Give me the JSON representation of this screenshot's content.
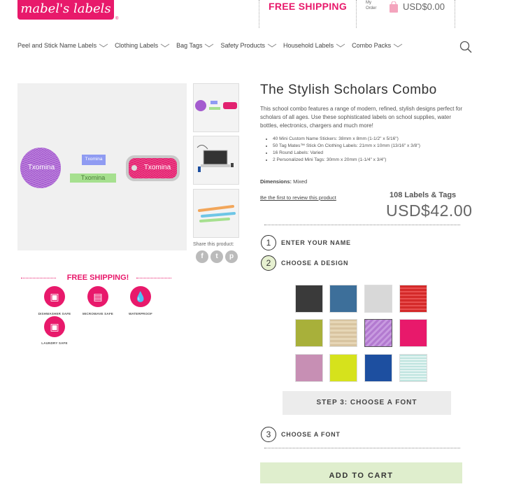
{
  "header": {
    "logo_text": "mabel's labels",
    "logo_mark": "®",
    "free_shipping": "FREE SHIPPING",
    "my_order": "My Order",
    "cart_total": "USD$0.00"
  },
  "nav": [
    {
      "label": "Peel and Stick Name Labels"
    },
    {
      "label": "Clothing Labels"
    },
    {
      "label": "Bag Tags"
    },
    {
      "label": "Safety Products"
    },
    {
      "label": "Household Labels"
    },
    {
      "label": "Combo Packs"
    }
  ],
  "gallery": {
    "sample_name": "Txomina",
    "share_text": "Share this product:"
  },
  "shipping": {
    "title": "FREE SHIPPING!",
    "badges": [
      {
        "label": "DISHWASHER SAFE",
        "icon": "dishwasher-icon"
      },
      {
        "label": "MICROWAVE SAFE",
        "icon": "microwave-icon"
      },
      {
        "label": "WATERPROOF",
        "icon": "waterproof-icon"
      },
      {
        "label": "LAUNDRY SAFE",
        "icon": "laundry-icon"
      }
    ]
  },
  "product": {
    "title": "The Stylish Scholars Combo",
    "description": "This school combo features a range of modern, refined, stylish designs perfect for scholars of all ages. Use these sophisticated labels on school supplies, water bottles, electronics, chargers and much more!",
    "features": [
      "40 Mini Custom Name Stickers: 38mm x 8mm (1-1/2\" x 5/16\")",
      "50 Tag Mates™ Stick On Clothing Labels: 21mm x 10mm (13/16\" x 3/8\")",
      "16 Round Labels: Varied",
      "2 Personalized Mini Tags: 30mm x 20mm (1-1/4\" x 3/4\")"
    ],
    "dimensions_label": "Dimensions:",
    "dimensions_value": "Mixed",
    "review_link": "Be the first to review this product",
    "quantity": "108 Labels & Tags",
    "price": "USD$42.00"
  },
  "steps": [
    {
      "number": "1",
      "label": "ENTER YOUR NAME"
    },
    {
      "number": "2",
      "label": "CHOOSE A DESIGN"
    },
    {
      "number": "3",
      "label": "CHOOSE A FONT"
    }
  ],
  "swatches": [
    {
      "name": "charcoal",
      "color": "#3a3a3a"
    },
    {
      "name": "blue-floral",
      "color": "#3d6f9a"
    },
    {
      "name": "grey-geo",
      "color": "#d8d8d8"
    },
    {
      "name": "red-stripe",
      "color": "#d42a2a"
    },
    {
      "name": "lime-wood",
      "color": "#a8b03a"
    },
    {
      "name": "tan-wood",
      "color": "#d8c4a0"
    },
    {
      "name": "purple-chevron",
      "color": "#b37ad0"
    },
    {
      "name": "pink-dots",
      "color": "#e8196b"
    },
    {
      "name": "mauve-floral",
      "color": "#c78fb4"
    },
    {
      "name": "lime",
      "color": "#d6e21c"
    },
    {
      "name": "navy-quatrefoil",
      "color": "#1d4fa0"
    },
    {
      "name": "mint-stripe",
      "color": "#bfe4df"
    }
  ],
  "font_bar": "STEP 3: CHOOSE A FONT",
  "add_to_cart": "ADD TO CART",
  "colors": {
    "brand": "#e8196b",
    "accent": "#dfeecd"
  }
}
